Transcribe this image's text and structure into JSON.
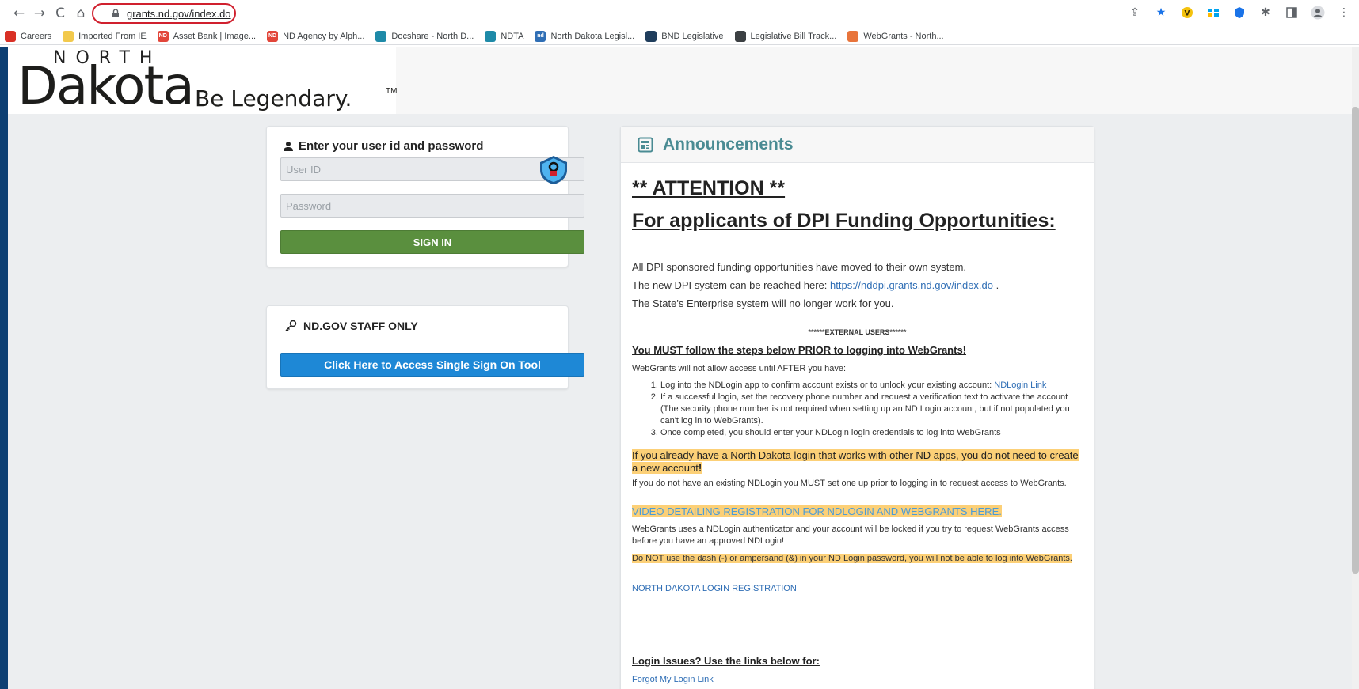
{
  "browser": {
    "url": "grants.nd.gov/index.do",
    "nav_back": "←",
    "nav_forward": "→",
    "nav_reload": "C",
    "nav_home": "⌂",
    "bookmarks": [
      {
        "label": "Careers",
        "color": "#d93025",
        "icon": ""
      },
      {
        "label": "Imported From IE",
        "color": "#f2c94c",
        "icon": ""
      },
      {
        "label": "Asset Bank | Image...",
        "color": "#e2463a",
        "icon": "ND"
      },
      {
        "label": "ND Agency by Alph...",
        "color": "#e2463a",
        "icon": "ND"
      },
      {
        "label": "Docshare - North D...",
        "color": "#1e8aa8",
        "icon": ""
      },
      {
        "label": "NDTA",
        "color": "#1e8aa8",
        "icon": ""
      },
      {
        "label": "North Dakota Legisl...",
        "color": "#2f6eb5",
        "icon": "nd"
      },
      {
        "label": "BND Legislative",
        "color": "#1f3d5c",
        "icon": ""
      },
      {
        "label": "Legislative Bill Track...",
        "color": "#3c4043",
        "icon": ""
      },
      {
        "label": "WebGrants - North...",
        "color": "#e8743b",
        "icon": ""
      }
    ]
  },
  "header": {
    "logo_north": "NORTH",
    "logo_dakota": "Dakota",
    "logo_tagline": "Be Legendary.",
    "logo_tm": "TM"
  },
  "login": {
    "heading": "Enter your user id and password",
    "userid_placeholder": "User ID",
    "password_placeholder": "Password",
    "signin_label": "SIGN IN"
  },
  "staff": {
    "heading": "ND.GOV STAFF ONLY",
    "sso_label": "Click Here to Access Single Sign On Tool"
  },
  "announcements": {
    "title": "Announcements",
    "attention": "** ATTENTION **",
    "dpi_heading": "For applicants of DPI Funding Opportunities:",
    "dpi_line1": "All DPI sponsored funding opportunities have moved to their own system.",
    "dpi_line2_prefix": "The new DPI system can be reached here:  ",
    "dpi_link": "https://nddpi.grants.nd.gov/index.do",
    "dpi_line2_suffix": " .",
    "dpi_line3": "The State's Enterprise system will no longer work for you.",
    "external_users": "******EXTERNAL USERS******",
    "must_follow": "You MUST follow the steps below PRIOR to logging into WebGrants!",
    "allow_line": "WebGrants will not allow access until AFTER you have:",
    "step1_text": "Log into the NDLogin app to confirm account exists or to unlock your existing account:  ",
    "step1_link": "NDLogin Link",
    "step2": "If a successful login, set the recovery phone number and request a verification text to activate the account (The security phone number is not required when setting up an ND Login account, but if not populated you can't log in to WebGrants).",
    "step3": "Once completed, you should enter your NDLogin login credentials to log into WebGrants",
    "already_text": "If you already have a North Dakota login that works with other ND apps, you do not need to create a new account",
    "already_bang": "!",
    "no_login": "If you do not have an existing NDLogin you MUST set one up prior to logging in to request access to WebGrants.",
    "video_link": "VIDEO DETAILING REGISTRATION FOR NDLOGIN AND WEBGRANTS HERE.",
    "authenticator": "WebGrants uses a NDLogin authenticator and your account will be locked if you try to request WebGrants access before you have an approved NDLogin!",
    "dash_warning": "Do NOT use the dash (-) or ampersand (&) in your ND Login password, you will not be able to log into WebGrants.",
    "nd_registration": "NORTH DAKOTA LOGIN REGISTRATION",
    "login_issues": "Login Issues?  Use the links below for:",
    "forgot_link": "Forgot My Login Link"
  },
  "colors": {
    "signin_green": "#5a8f3e",
    "sso_blue": "#1e88d6",
    "announcement_teal": "#4a8b93",
    "highlight": "#fcd077",
    "link_blue": "#2f6eb5"
  }
}
